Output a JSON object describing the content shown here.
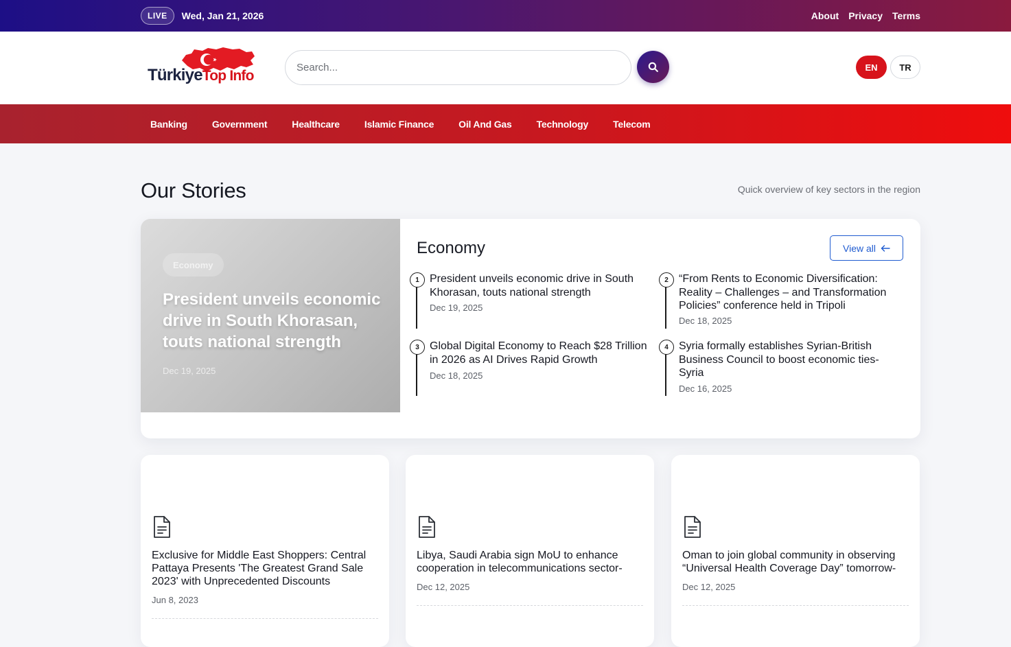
{
  "topbar": {
    "live_label": "LIVE",
    "date": "Wed, Jan 21, 2026",
    "links": [
      "About",
      "Privacy",
      "Terms"
    ]
  },
  "header": {
    "logo_word1": "Türkiye",
    "logo_word2": "Top Info",
    "search_placeholder": "Search...",
    "languages": [
      "EN",
      "TR"
    ],
    "active_language": "EN"
  },
  "nav": {
    "items": [
      "Banking",
      "Government",
      "Healthcare",
      "Islamic Finance",
      "Oil And Gas",
      "Technology",
      "Telecom"
    ]
  },
  "section": {
    "title": "Our Stories",
    "subtitle": "Quick overview of key sectors in the region"
  },
  "feature": {
    "category": "Economy",
    "view_all": "View all",
    "hero": {
      "tag": "Economy",
      "title": "President unveils economic drive in South Khorasan, touts national strength",
      "date": "Dec 19, 2025"
    },
    "stories": [
      {
        "num": "1",
        "title": "President unveils economic drive in South Khorasan, touts national strength",
        "date": "Dec 19, 2025"
      },
      {
        "num": "2",
        "title": "“From Rents to Economic Diversification: Reality – Challenges – and Transformation Policies” conference held in Tripoli",
        "date": "Dec 18, 2025"
      },
      {
        "num": "3",
        "title": "Global Digital Economy to Reach $28 Trillion in 2026 as AI Drives Rapid Growth",
        "date": "Dec 18, 2025"
      },
      {
        "num": "4",
        "title": "Syria formally establishes Syrian-British Business Council to boost economic ties-Syria",
        "date": "Dec 16, 2025"
      }
    ]
  },
  "cards": [
    {
      "title": "Exclusive for Middle East Shoppers: Central Pattaya Presents 'The Greatest Grand Sale 2023' with Unprecedented Discounts",
      "date": "Jun 8, 2023"
    },
    {
      "title": "Libya, Saudi Arabia sign MoU to enhance cooperation in telecommunications sector-",
      "date": "Dec 12, 2025"
    },
    {
      "title": "Oman to join global community in observing “Universal Health Coverage Day” tomorrow-",
      "date": "Dec 12, 2025"
    }
  ],
  "colors": {
    "brand_red": "#d7131b",
    "accent_blue": "#1f5bd0",
    "topbar_start": "#1d0f86",
    "topbar_end": "#8a1a3e"
  },
  "icons": {
    "search": "search-icon",
    "view_all": "arrow-left-icon",
    "card": "document-icon",
    "logo": "turkey-flag-map"
  }
}
